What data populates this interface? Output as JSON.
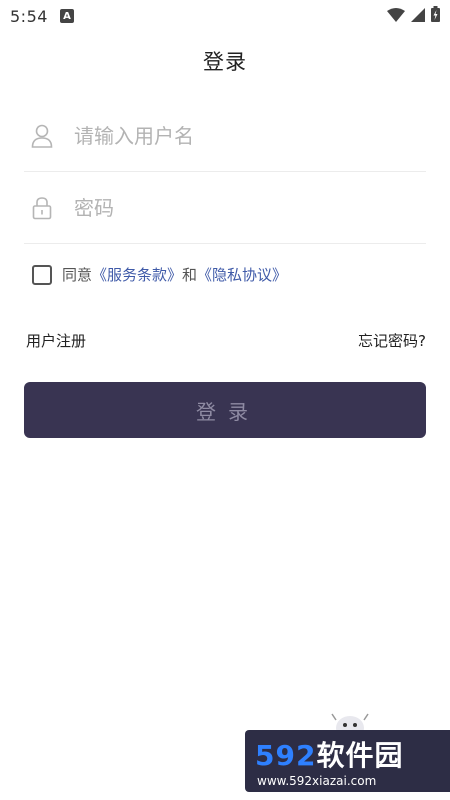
{
  "status_bar": {
    "time": "5:54",
    "app_badge": "A",
    "icons": [
      "wifi-icon",
      "signal-icon",
      "battery-icon"
    ]
  },
  "header": {
    "title": "登录"
  },
  "form": {
    "username_placeholder": "请输入用户名",
    "password_placeholder": "密码",
    "agree_prefix": "同意",
    "terms_link": "《服务条款》",
    "and_text": "和",
    "privacy_link": "《隐私协议》",
    "agreed": false
  },
  "links": {
    "register": "用户注册",
    "forgot_password": "忘记密码?"
  },
  "login_button": {
    "label": "登录"
  },
  "watermark": {
    "brand_number": "592",
    "brand_cn": "软件园",
    "url": "www.592xiazai.com"
  },
  "colors": {
    "primary_button": "#393452",
    "button_text": "#8f8ba3",
    "link": "#3f5aa8",
    "placeholder": "#b3b3b3"
  }
}
